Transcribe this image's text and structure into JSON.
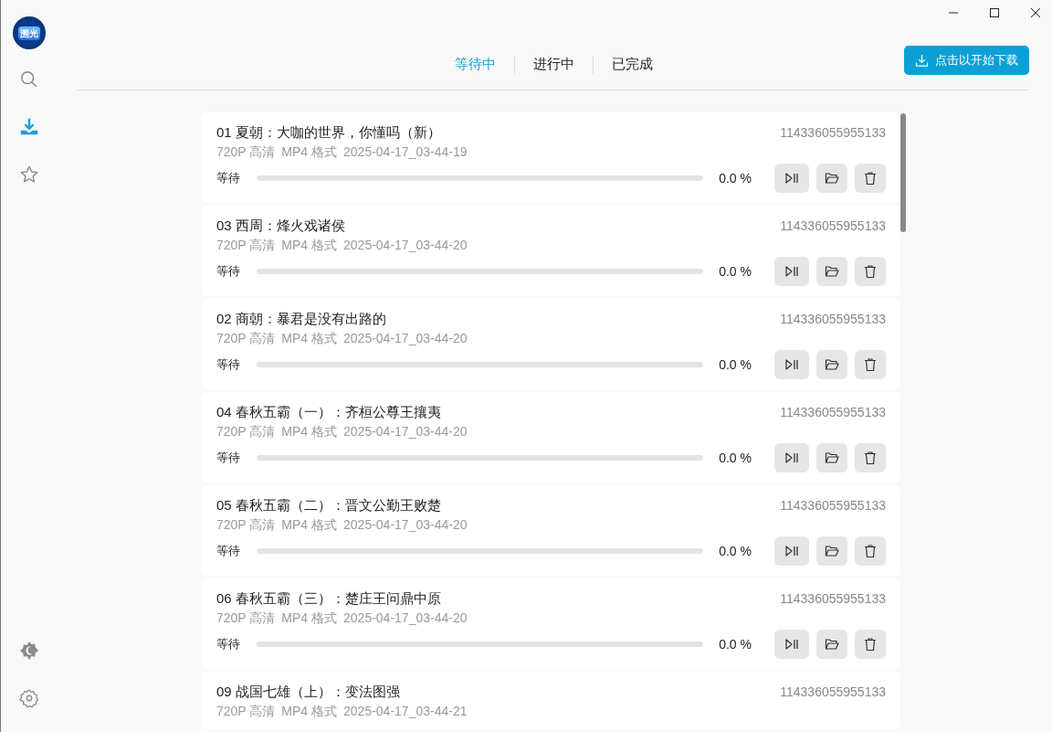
{
  "app": {
    "logo_text": "溯光"
  },
  "sidebar": {
    "items": [
      {
        "kind": "search",
        "selected": false
      },
      {
        "kind": "download",
        "selected": true
      },
      {
        "kind": "star",
        "selected": false
      }
    ],
    "bottom_items": [
      {
        "kind": "theme"
      },
      {
        "kind": "settings"
      }
    ]
  },
  "tabs": [
    {
      "label": "等待中",
      "selected": true
    },
    {
      "label": "进行中",
      "selected": false
    },
    {
      "label": "已完成",
      "selected": false
    }
  ],
  "start_button": {
    "label": "点击以开始下载"
  },
  "downloads": [
    {
      "title": "01 夏朝：大咖的世界，你懂吗（新）",
      "id": "114336055955133",
      "quality": "720P 高清",
      "format": "MP4 格式",
      "time": "2025-04-17_03-44-19",
      "status": "等待",
      "level": 0,
      "percent": "0.0 %"
    },
    {
      "title": "03 西周：烽火戏诸侯",
      "id": "114336055955133",
      "quality": "720P 高清",
      "format": "MP4 格式",
      "time": "2025-04-17_03-44-20",
      "status": "等待",
      "level": 0,
      "percent": "0.0 %"
    },
    {
      "title": "02 商朝：暴君是没有出路的",
      "id": "114336055955133",
      "quality": "720P 高清",
      "format": "MP4 格式",
      "time": "2025-04-17_03-44-20",
      "status": "等待",
      "level": 0,
      "percent": "0.0 %"
    },
    {
      "title": "04 春秋五霸（一）：齐桓公尊王攘夷",
      "id": "114336055955133",
      "quality": "720P 高清",
      "format": "MP4 格式",
      "time": "2025-04-17_03-44-20",
      "status": "等待",
      "level": 0,
      "percent": "0.0 %"
    },
    {
      "title": "05 春秋五霸（二）：晋文公勤王败楚",
      "id": "114336055955133",
      "quality": "720P 高清",
      "format": "MP4 格式",
      "time": "2025-04-17_03-44-20",
      "status": "等待",
      "level": 0,
      "percent": "0.0 %"
    },
    {
      "title": "06 春秋五霸（三）：楚庄王问鼎中原",
      "id": "114336055955133",
      "quality": "720P 高清",
      "format": "MP4 格式",
      "time": "2025-04-17_03-44-20",
      "status": "等待",
      "level": 0,
      "percent": "0.0 %"
    },
    {
      "title": "09 战国七雄（上）：变法图强",
      "id": "114336055955133",
      "quality": "720P 高清",
      "format": "MP4 格式",
      "time": "2025-04-17_03-44-21"
    }
  ]
}
